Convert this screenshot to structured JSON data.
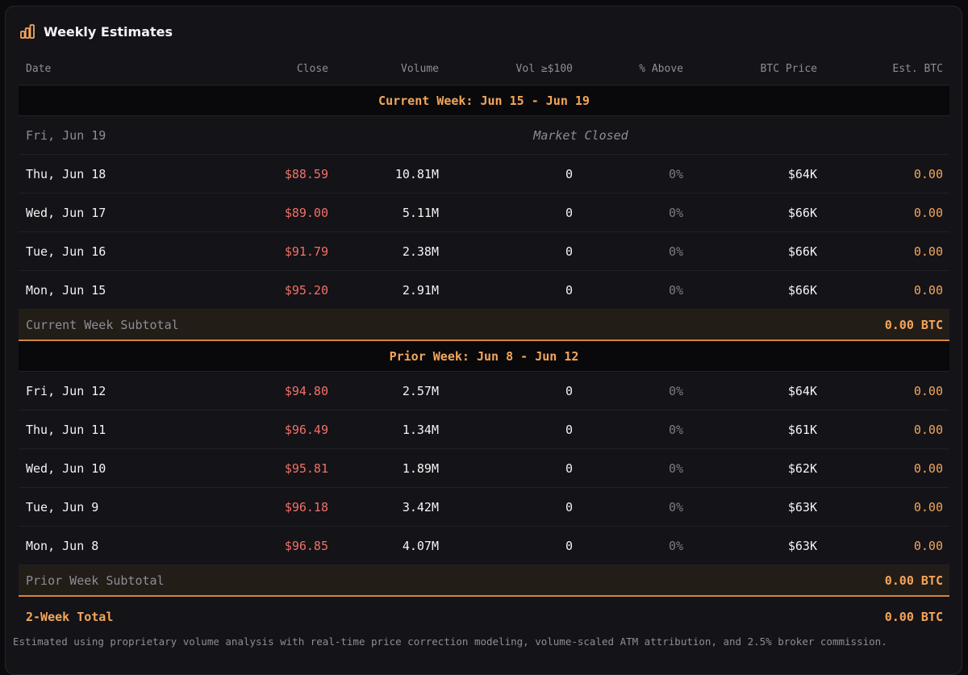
{
  "panel": {
    "title": "Weekly Estimates",
    "icon": "bar-chart-icon",
    "accent": "#f4a65b"
  },
  "columns": {
    "date": "Date",
    "close": "Close",
    "volume": "Volume",
    "vol_100": "Vol ≥$100",
    "pct_above": "% Above",
    "btc_price": "BTC Price",
    "est_btc": "Est. BTC"
  },
  "current_week": {
    "label": "Current Week: Jun 15 - Jun 19",
    "closed_day": {
      "date": "Fri, Jun 19",
      "note": "Market Closed"
    },
    "days": [
      {
        "date": "Thu, Jun 18",
        "close": "$88.59",
        "volume": "10.81M",
        "vol_100": "0",
        "pct_above": "0%",
        "btc_price": "$64K",
        "est_btc": "0.00"
      },
      {
        "date": "Wed, Jun 17",
        "close": "$89.00",
        "volume": "5.11M",
        "vol_100": "0",
        "pct_above": "0%",
        "btc_price": "$66K",
        "est_btc": "0.00"
      },
      {
        "date": "Tue, Jun 16",
        "close": "$91.79",
        "volume": "2.38M",
        "vol_100": "0",
        "pct_above": "0%",
        "btc_price": "$66K",
        "est_btc": "0.00"
      },
      {
        "date": "Mon, Jun 15",
        "close": "$95.20",
        "volume": "2.91M",
        "vol_100": "0",
        "pct_above": "0%",
        "btc_price": "$66K",
        "est_btc": "0.00"
      }
    ],
    "subtotal_label": "Current Week Subtotal",
    "subtotal_value": "0.00 BTC"
  },
  "prior_week": {
    "label": "Prior Week: Jun 8 - Jun 12",
    "days": [
      {
        "date": "Fri, Jun 12",
        "close": "$94.80",
        "volume": "2.57M",
        "vol_100": "0",
        "pct_above": "0%",
        "btc_price": "$64K",
        "est_btc": "0.00"
      },
      {
        "date": "Thu, Jun 11",
        "close": "$96.49",
        "volume": "1.34M",
        "vol_100": "0",
        "pct_above": "0%",
        "btc_price": "$61K",
        "est_btc": "0.00"
      },
      {
        "date": "Wed, Jun 10",
        "close": "$95.81",
        "volume": "1.89M",
        "vol_100": "0",
        "pct_above": "0%",
        "btc_price": "$62K",
        "est_btc": "0.00"
      },
      {
        "date": "Tue, Jun 9",
        "close": "$96.18",
        "volume": "3.42M",
        "vol_100": "0",
        "pct_above": "0%",
        "btc_price": "$63K",
        "est_btc": "0.00"
      },
      {
        "date": "Mon, Jun 8",
        "close": "$96.85",
        "volume": "4.07M",
        "vol_100": "0",
        "pct_above": "0%",
        "btc_price": "$63K",
        "est_btc": "0.00"
      }
    ],
    "subtotal_label": "Prior Week Subtotal",
    "subtotal_value": "0.00 BTC"
  },
  "total": {
    "label": "2-Week Total",
    "value": "0.00 BTC"
  },
  "footnote": "Estimated using proprietary volume analysis with real-time price correction modeling, volume-scaled ATM attribution, and 2.5% broker commission."
}
